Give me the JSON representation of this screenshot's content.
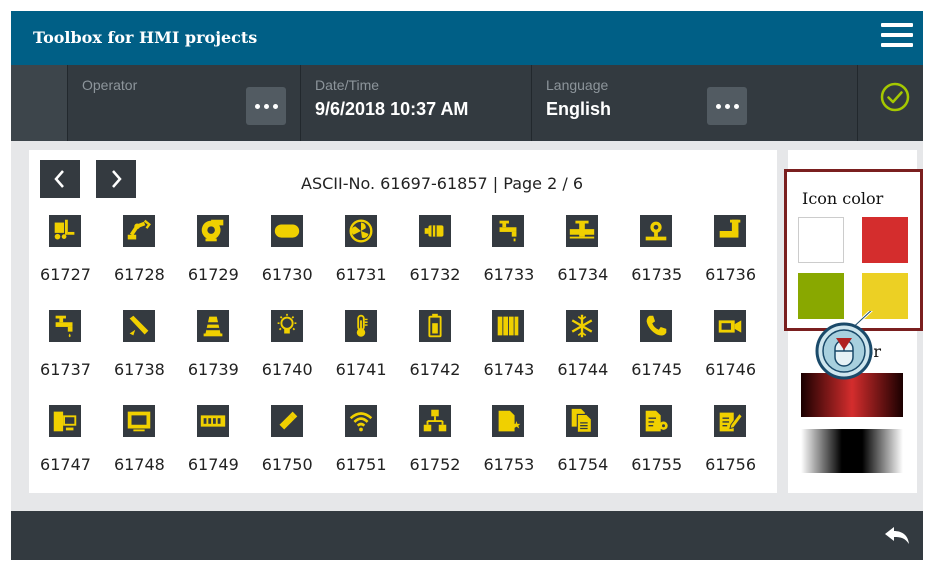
{
  "app": {
    "title": "Toolbox for HMI projects"
  },
  "status": {
    "operator": {
      "label": "Operator",
      "value": ""
    },
    "datetime": {
      "label": "Date/Time",
      "value": "9/6/2018 10:37 AM"
    },
    "language": {
      "label": "Language",
      "value": "English"
    }
  },
  "grid": {
    "page_info": "ASCII-No. 61697-61857 | Page 2 / 6",
    "icon_color": "#f0d000",
    "tile_color": "#343a40",
    "rows": [
      [
        {
          "num": "61727",
          "icon": "forklift-icon"
        },
        {
          "num": "61728",
          "icon": "robot-arm-icon"
        },
        {
          "num": "61729",
          "icon": "blower-fan-icon"
        },
        {
          "num": "61730",
          "icon": "tank-icon"
        },
        {
          "num": "61731",
          "icon": "fan-icon"
        },
        {
          "num": "61732",
          "icon": "motor-icon"
        },
        {
          "num": "61733",
          "icon": "tap-icon"
        },
        {
          "num": "61734",
          "icon": "valve-icon"
        },
        {
          "num": "61735",
          "icon": "pump-icon"
        },
        {
          "num": "61736",
          "icon": "pipe-icon"
        }
      ],
      [
        {
          "num": "61737",
          "icon": "faucet-icon"
        },
        {
          "num": "61738",
          "icon": "nozzle-icon"
        },
        {
          "num": "61739",
          "icon": "cone-icon"
        },
        {
          "num": "61740",
          "icon": "lightbulb-icon"
        },
        {
          "num": "61741",
          "icon": "thermometer-icon"
        },
        {
          "num": "61742",
          "icon": "battery-icon"
        },
        {
          "num": "61743",
          "icon": "radiator-icon"
        },
        {
          "num": "61744",
          "icon": "snowflake-icon"
        },
        {
          "num": "61745",
          "icon": "phone-icon"
        },
        {
          "num": "61746",
          "icon": "video-camera-icon"
        }
      ],
      [
        {
          "num": "61747",
          "icon": "computer-icon"
        },
        {
          "num": "61748",
          "icon": "monitor-icon"
        },
        {
          "num": "61749",
          "icon": "memory-module-icon"
        },
        {
          "num": "61750",
          "icon": "usb-stick-icon"
        },
        {
          "num": "61751",
          "icon": "wifi-icon"
        },
        {
          "num": "61752",
          "icon": "network-icon"
        },
        {
          "num": "61753",
          "icon": "document-star-icon"
        },
        {
          "num": "61754",
          "icon": "documents-icon"
        },
        {
          "num": "61755",
          "icon": "document-settings-icon"
        },
        {
          "num": "61756",
          "icon": "document-edit-icon"
        }
      ]
    ]
  },
  "side": {
    "icon_color_label": "Icon color",
    "background_color_label_visible": "olor",
    "swatches": [
      "#ffffff",
      "#d42d2d",
      "#89a800",
      "#ecd024"
    ]
  }
}
